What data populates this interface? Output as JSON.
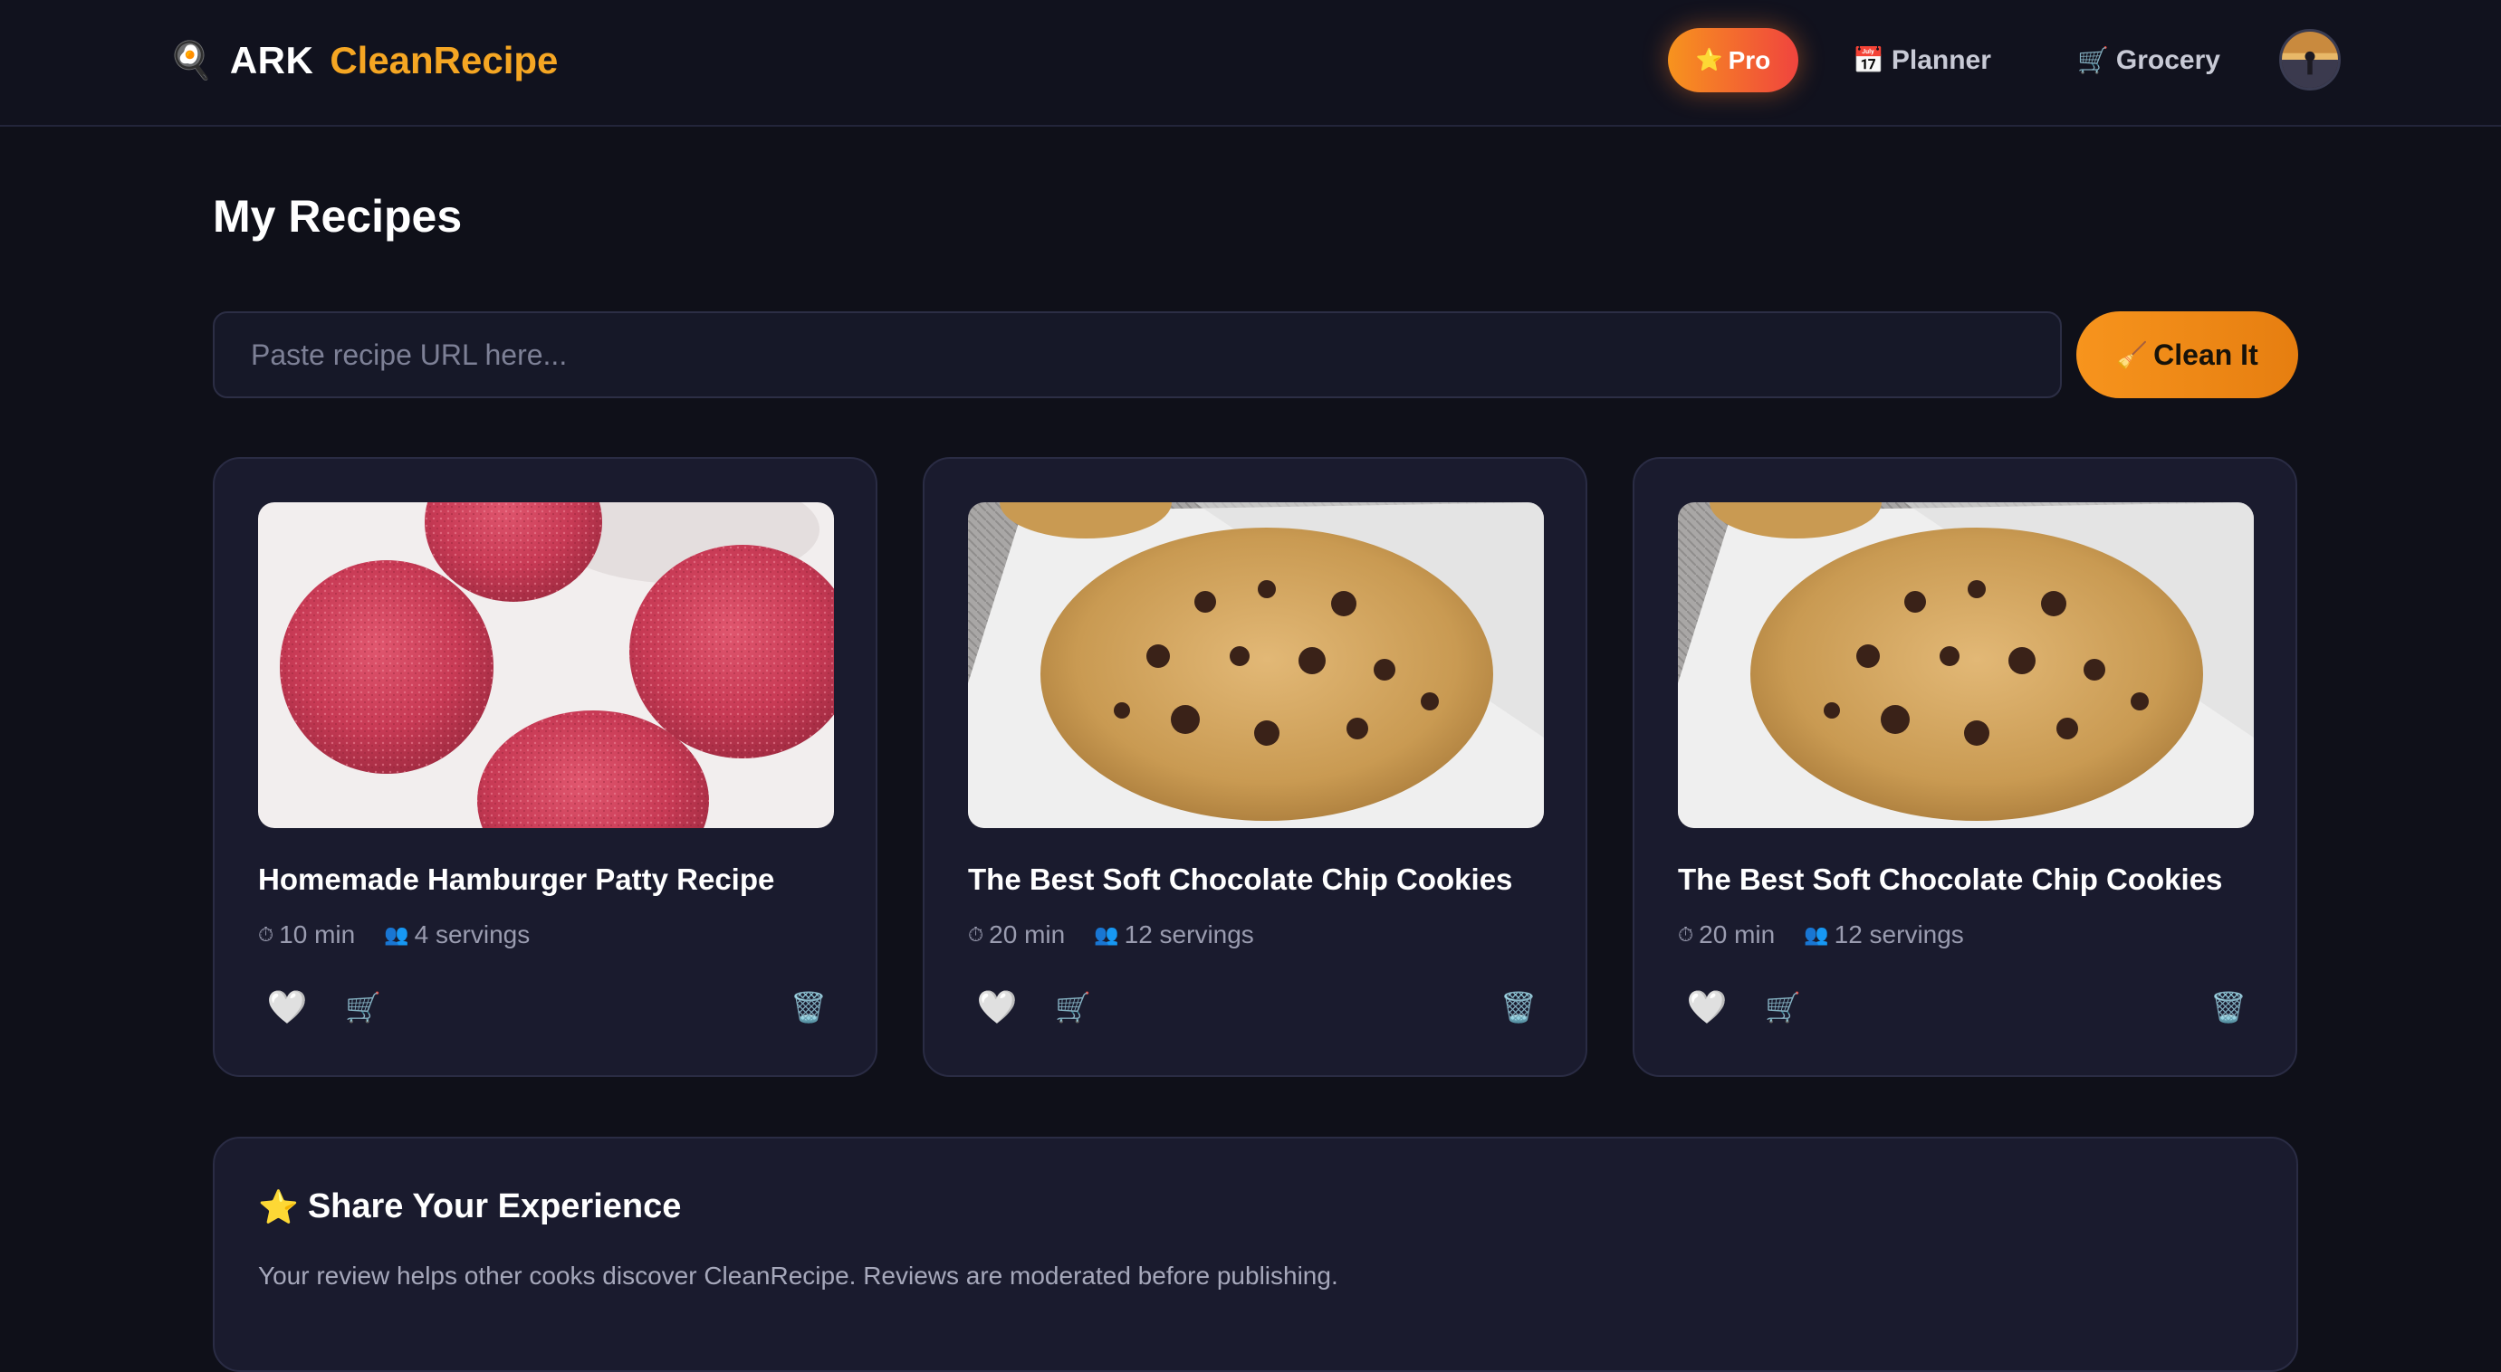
{
  "header": {
    "logo_icon": "magnifier-egg-icon",
    "brand_prefix": "ARK",
    "brand_name": "CleanRecipe",
    "brand_color": "#f5a623",
    "pro": {
      "icon": "⭐",
      "label": "Pro"
    },
    "nav": [
      {
        "icon": "📅",
        "label": "Planner"
      },
      {
        "icon": "🛒",
        "label": "Grocery"
      }
    ]
  },
  "main": {
    "title": "My Recipes",
    "url_input": {
      "placeholder": "Paste recipe URL here...",
      "value": ""
    },
    "clean_button": {
      "icon": "🧹",
      "label": "Clean It"
    },
    "recipes": [
      {
        "title": "Homemade Hamburger Patty Recipe",
        "time": "10 min",
        "servings": "4 servings",
        "image": "hamburger-patties"
      },
      {
        "title": "The Best Soft Chocolate Chip Cookies",
        "time": "20 min",
        "servings": "12 servings",
        "image": "chocolate-chip-cookie"
      },
      {
        "title": "The Best Soft Chocolate Chip Cookies",
        "time": "20 min",
        "servings": "12 servings",
        "image": "chocolate-chip-cookie"
      }
    ],
    "card_icons": {
      "time": "⏱",
      "servings": "👥",
      "favorite": "🤍",
      "cart": "🛒",
      "delete": "🗑️"
    }
  },
  "review": {
    "icon": "⭐",
    "title": "Share Your Experience",
    "description": "Your review helps other cooks discover CleanRecipe. Reviews are moderated before publishing."
  },
  "colors": {
    "background": "#0f1019",
    "card": "#1a1b2e",
    "accent_orange": "#f7941d",
    "pro_gradient_end": "#f0443e"
  }
}
